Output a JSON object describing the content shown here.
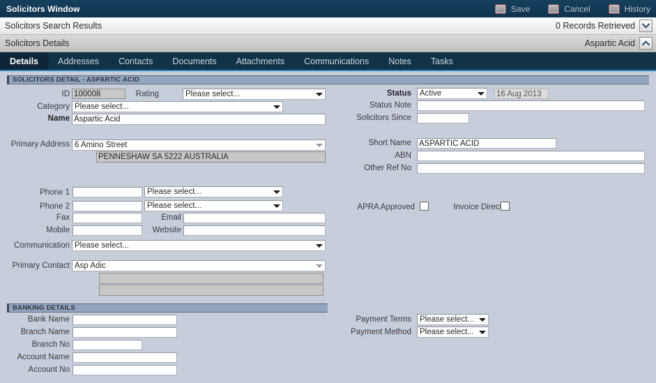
{
  "window": {
    "title": "Solicitors Window",
    "actions": [
      {
        "label": "Save",
        "icon": "save-icon"
      },
      {
        "label": "Cancel",
        "icon": "cancel-icon"
      },
      {
        "label": "History",
        "icon": "history-icon"
      }
    ]
  },
  "search_results_bar": {
    "title": "Solicitors Search Results",
    "records_text": "0 Records Retrieved",
    "toggle_icon": "chevron-down-icon"
  },
  "details_bar": {
    "title": "Solicitors Details",
    "record_name": "Aspartic Acid",
    "toggle_icon": "chevron-up-icon"
  },
  "tabs": [
    {
      "label": "Details",
      "active": true
    },
    {
      "label": "Addresses",
      "active": false
    },
    {
      "label": "Contacts",
      "active": false
    },
    {
      "label": "Documents",
      "active": false
    },
    {
      "label": "Attachments",
      "active": false
    },
    {
      "label": "Communications",
      "active": false
    },
    {
      "label": "Notes",
      "active": false
    },
    {
      "label": "Tasks",
      "active": false
    }
  ],
  "sections": {
    "detail": {
      "title": "SOLICITORS DETAIL - ASPARTIC ACID"
    },
    "banking": {
      "title": "BANKING DETAILS"
    }
  },
  "fields": {
    "id": {
      "label": "ID",
      "value": "100008"
    },
    "rating": {
      "label": "Rating",
      "value": "Please select..."
    },
    "category": {
      "label": "Category",
      "value": "Please select..."
    },
    "name": {
      "label": "Name",
      "value": "Aspartic Acid"
    },
    "primary_address": {
      "label": "Primary Address",
      "value": "6 Amino Street"
    },
    "primary_address_line2": {
      "value": "PENNESHAW SA 5222 AUSTRALIA"
    },
    "status": {
      "label": "Status",
      "value": "Active"
    },
    "status_date": {
      "value": "16 Aug 2013"
    },
    "status_note": {
      "label": "Status Note",
      "value": ""
    },
    "solicitors_since": {
      "label": "Solicitors Since",
      "value": ""
    },
    "short_name": {
      "label": "Short Name",
      "value": "ASPARTIC ACID"
    },
    "abn": {
      "label": "ABN",
      "value": ""
    },
    "other_ref_no": {
      "label": "Other Ref No",
      "value": ""
    },
    "phone1": {
      "label": "Phone 1",
      "value": "",
      "type_value": "Please select..."
    },
    "phone2": {
      "label": "Phone 2",
      "value": "",
      "type_value": "Please select..."
    },
    "fax": {
      "label": "Fax",
      "value": ""
    },
    "email": {
      "label": "Email",
      "value": ""
    },
    "mobile": {
      "label": "Mobile",
      "value": ""
    },
    "website": {
      "label": "Website",
      "value": ""
    },
    "communication": {
      "label": "Communication",
      "value": "Please select..."
    },
    "primary_contact": {
      "label": "Primary Contact",
      "value": "Asp Adic"
    },
    "primary_contact_line2": {
      "value": ""
    },
    "primary_contact_line3": {
      "value": ""
    },
    "apra_approved": {
      "label": "APRA Approved",
      "checked": false
    },
    "invoice_direct": {
      "label": "Invoice Direct",
      "checked": false
    },
    "bank_name": {
      "label": "Bank Name",
      "value": ""
    },
    "branch_name": {
      "label": "Branch Name",
      "value": ""
    },
    "branch_no": {
      "label": "Branch No",
      "value": ""
    },
    "account_name": {
      "label": "Account Name",
      "value": ""
    },
    "account_no": {
      "label": "Account No",
      "value": ""
    },
    "payment_terms": {
      "label": "Payment Terms",
      "value": "Please select..."
    },
    "payment_method": {
      "label": "Payment Method",
      "value": "Please select..."
    }
  },
  "colors": {
    "title_bar": "#123a55",
    "tab_bar": "#123248",
    "tab_active": "#0d2739",
    "tab_underline": "#2e82b8",
    "form_background": "#c7cedb",
    "section_header": "#94a5c0"
  }
}
